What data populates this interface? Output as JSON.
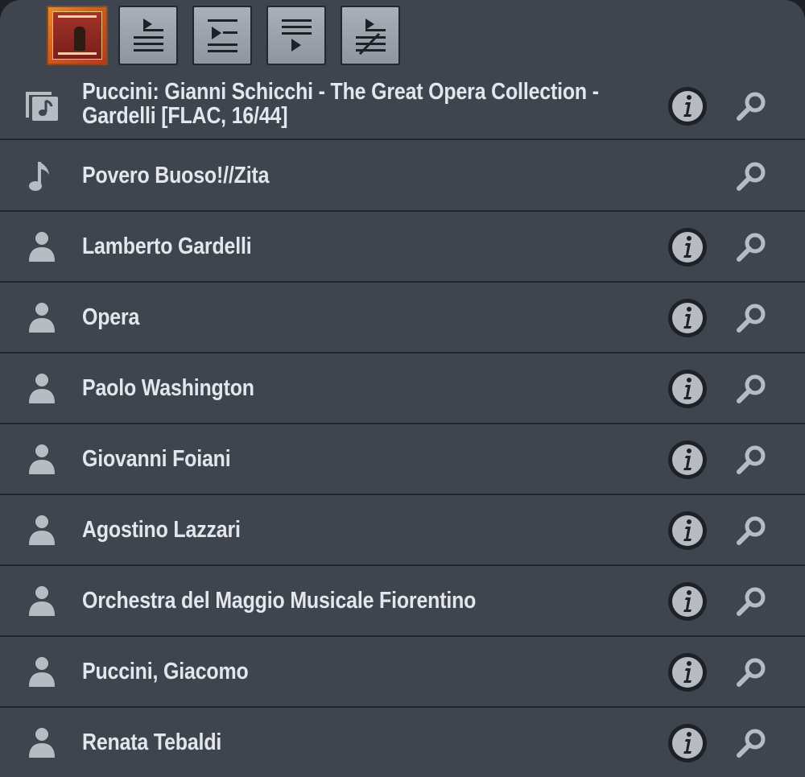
{
  "toolbar": {
    "cover_art": "album-cover",
    "buttons": [
      {
        "name": "play-now-button",
        "icon": "play-list-icon"
      },
      {
        "name": "play-next-button",
        "icon": "insert-next-icon"
      },
      {
        "name": "add-to-queue-button",
        "icon": "add-end-icon"
      },
      {
        "name": "play-and-replace-button",
        "icon": "play-replace-icon"
      }
    ]
  },
  "colors": {
    "panel": "#3e454f",
    "divider": "#22262c",
    "text": "#e3e6ea",
    "icon": "#b7bcc3"
  },
  "items": [
    {
      "type": "album",
      "icon": "album-icon",
      "label_line1": "Puccini: Gianni Schicchi - The Great Opera Collection -",
      "label_line2": "Gardelli [FLAC, 16/44]",
      "has_info": true
    },
    {
      "type": "track",
      "icon": "music-note-icon",
      "label": "Povero Buoso!//Zita",
      "has_info": false
    },
    {
      "type": "artist",
      "icon": "person-icon",
      "label": "Lamberto Gardelli",
      "has_info": true
    },
    {
      "type": "artist",
      "icon": "person-icon",
      "label": "Opera",
      "has_info": true
    },
    {
      "type": "artist",
      "icon": "person-icon",
      "label": "Paolo Washington",
      "has_info": true
    },
    {
      "type": "artist",
      "icon": "person-icon",
      "label": "Giovanni Foiani",
      "has_info": true
    },
    {
      "type": "artist",
      "icon": "person-icon",
      "label": "Agostino Lazzari",
      "has_info": true
    },
    {
      "type": "artist",
      "icon": "person-icon",
      "label": "Orchestra del Maggio Musicale Fiorentino",
      "has_info": true
    },
    {
      "type": "artist",
      "icon": "person-icon",
      "label": "Puccini, Giacomo",
      "has_info": true
    },
    {
      "type": "artist",
      "icon": "person-icon",
      "label": "Renata Tebaldi",
      "has_info": true
    }
  ]
}
